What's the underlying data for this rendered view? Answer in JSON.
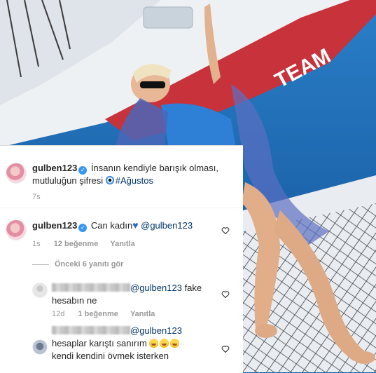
{
  "caption": {
    "username": "gulben123",
    "text_line1": "İnsanın kendiyle barışık olması,",
    "text_line2_pre": "mutluluğun şifresi",
    "hashtag": "#Ağustos",
    "time": "7s"
  },
  "comment1": {
    "username": "gulben123",
    "text": "Can kadın",
    "mention": "@gulben123",
    "time": "1s",
    "likes": "12 beğenme",
    "reply_label": "Yanıtla"
  },
  "view_replies": "Önceki 6 yanıtı gör",
  "reply1": {
    "mention": "@gulben123",
    "text_suffix": "fake",
    "text_line2": "hesabın ne",
    "time": "12d",
    "likes": "1 beğenme",
    "reply_label": "Yanıtla"
  },
  "reply2": {
    "mention": "@gulben123",
    "text_line1": "hesaplar karıştı sanırım",
    "text_line2": "kendi kendini övmek isterken"
  },
  "colors": {
    "sea": "#1e6bb4",
    "boat_red": "#c8323a",
    "verified_blue": "#3897f0",
    "link": "#003569"
  }
}
